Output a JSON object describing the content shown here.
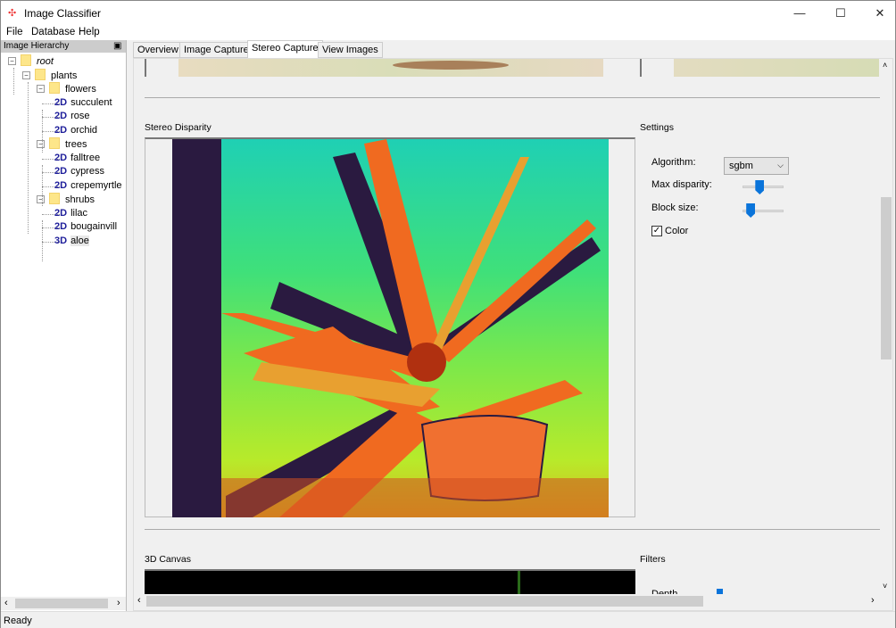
{
  "window": {
    "title": "Image Classifier",
    "icon": "app-icon",
    "controls": [
      "minimize",
      "maximize",
      "close"
    ]
  },
  "menu": [
    "File",
    "Database",
    "Help"
  ],
  "left_panel": {
    "title": "Image Hierarchy",
    "tree": [
      {
        "label": "root",
        "level": 0,
        "type": "folder"
      },
      {
        "label": "plants",
        "level": 1,
        "type": "folder"
      },
      {
        "label": "flowers",
        "level": 2,
        "type": "folder"
      },
      {
        "label": "succulent",
        "level": 3,
        "type": "2D"
      },
      {
        "label": "rose",
        "level": 3,
        "type": "2D"
      },
      {
        "label": "orchid",
        "level": 3,
        "type": "2D"
      },
      {
        "label": "trees",
        "level": 2,
        "type": "folder"
      },
      {
        "label": "falltree",
        "level": 3,
        "type": "2D"
      },
      {
        "label": "cypress",
        "level": 3,
        "type": "2D"
      },
      {
        "label": "crepemyrtle",
        "level": 3,
        "type": "2D"
      },
      {
        "label": "shrubs",
        "level": 2,
        "type": "folder"
      },
      {
        "label": "lilac",
        "level": 3,
        "type": "2D"
      },
      {
        "label": "bougainvill",
        "level": 3,
        "type": "2D"
      },
      {
        "label": "aloe",
        "level": 3,
        "type": "3D",
        "selected": true
      }
    ]
  },
  "tabs": [
    {
      "label": "Overview"
    },
    {
      "label": "Image Capture"
    },
    {
      "label": "Stereo Capture",
      "active": true
    },
    {
      "label": "View Images"
    }
  ],
  "stereo": {
    "disparity_label": "Stereo Disparity",
    "settings_label": "Settings",
    "algorithm_label": "Algorithm:",
    "algorithm_value": "sgbm",
    "max_disparity_label": "Max disparity:",
    "max_disparity_level": 0.42,
    "block_size_label": "Block size:",
    "block_size_level": 0.2,
    "color_label": "Color",
    "color_checked": true
  },
  "canvas": {
    "label": "3D Canvas",
    "filters_label": "Filters",
    "depth_label": "Depth"
  },
  "status": "Ready",
  "colors": {
    "accent": "#0a74da",
    "disparity_background": "#2a1a40"
  }
}
